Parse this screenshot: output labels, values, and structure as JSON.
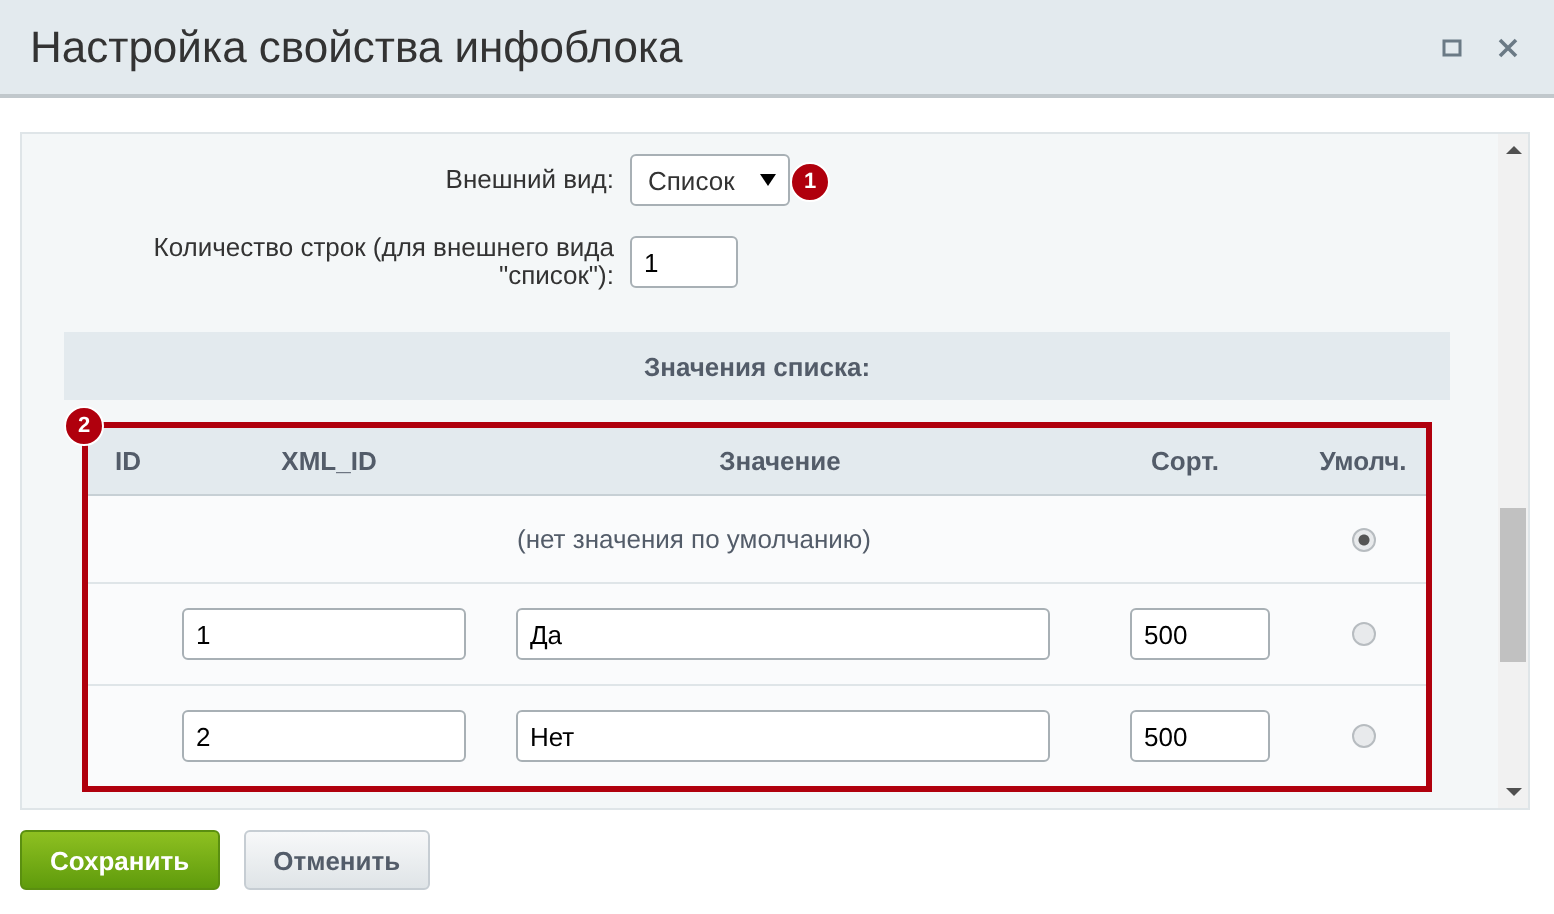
{
  "window": {
    "title": "Настройка свойства инфоблока"
  },
  "form": {
    "appearance": {
      "label": "Внешний вид:",
      "value": "Список",
      "marker": "1"
    },
    "rows_count": {
      "label": "Количество строк (для внешнего вида \"список\"):",
      "value": "1"
    }
  },
  "section_title": "Значения списка:",
  "table": {
    "marker": "2",
    "columns": [
      "ID",
      "XML_ID",
      "Значение",
      "Сорт.",
      "Умолч."
    ],
    "rows": [
      {
        "kind": "default",
        "text": "(нет значения по умолчанию)",
        "selected": true
      },
      {
        "kind": "value",
        "xml_id": "1",
        "value": "Да",
        "sort": "500",
        "selected": false
      },
      {
        "kind": "value",
        "xml_id": "2",
        "value": "Нет",
        "sort": "500",
        "selected": false
      }
    ]
  },
  "buttons": [
    {
      "label": "Сохранить",
      "kind": "primary"
    },
    {
      "label": "Отменить",
      "kind": "secondary"
    }
  ]
}
